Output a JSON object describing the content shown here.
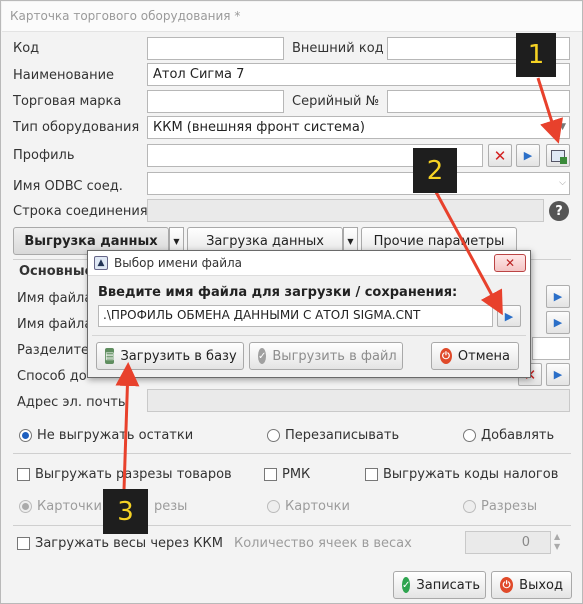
{
  "window": {
    "title": "Карточка торгового оборудования *"
  },
  "form": {
    "code_label": "Код",
    "code_value": "",
    "ext_code_label": "Внешний код",
    "ext_code_value": "",
    "name_label": "Наименование",
    "name_value": "Атол Сигма 7",
    "brand_label": "Торговая марка",
    "brand_value": "",
    "serial_label": "Серийный №",
    "serial_value": "",
    "type_label": "Тип оборудования",
    "type_value": "ККМ (внешняя фронт система)",
    "profile_label": "Профиль",
    "profile_value": "",
    "odbc_label": "Имя ODBC соед.",
    "odbc_value": "",
    "conn_label": "Строка соединения",
    "conn_value": "",
    "help_label": "?"
  },
  "tabs": [
    {
      "label": "Выгрузка данных"
    },
    {
      "label": "Загрузка данных"
    },
    {
      "label": "Прочие параметры"
    }
  ],
  "section": {
    "title": "Основные",
    "file1_label": "Имя файла",
    "file2_label": "Имя файла",
    "sep_label": "Разделите",
    "method_label": "Способ до",
    "email_label": "Адрес эл. почты"
  },
  "stock": {
    "options": [
      "Не выгружать остатки",
      "Перезаписывать",
      "Добавлять"
    ],
    "selected": "Не выгружать остатки"
  },
  "checks": {
    "cuts": "Выгружать разрезы товаров",
    "rmk": "РМК",
    "tax": "Выгружать коды налогов"
  },
  "cards": {
    "options": [
      "Карточки и разрезы",
      "Карточки",
      "Разрезы"
    ],
    "opt1_visible": "Карточки и",
    "opt1_hidden": "резы",
    "selected": "Карточки и разрезы"
  },
  "weights": {
    "label": "Загружать весы через ККМ",
    "cells_label": "Количество ячеек в весах",
    "cells_value": "0"
  },
  "footer": {
    "save": "Записать",
    "exit": "Выход"
  },
  "dialog": {
    "title": "Выбор имени файла",
    "prompt": "Введите имя файла для загрузки / сохранения:",
    "filename": ".\\ПРОФИЛЬ ОБМЕНА ДАННЫМИ С АТОЛ SIGMA.CNT",
    "load": "Загрузить в базу",
    "unload": "Выгрузить в файл",
    "cancel": "Отмена",
    "close": "✕"
  },
  "annotations": {
    "step1": "1",
    "step2": "2",
    "step3": "3"
  },
  "colors": {
    "arrow": "#e8412c",
    "badge_bg": "#1e1e1e",
    "badge_fg": "#f5d224"
  }
}
